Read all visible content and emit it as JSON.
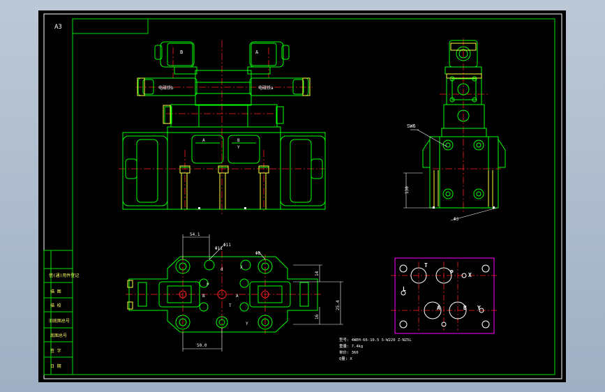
{
  "sheet": {
    "size_label": "A3"
  },
  "title_block": {
    "rows": [
      "借(通)用件登记",
      "描 图",
      "描 校",
      "旧底图总号",
      "底图总号",
      "签 字",
      "日 期"
    ]
  },
  "front_view": {
    "solenoid_left_letter": "B",
    "solenoid_right_letter": "A",
    "coil_left_label": "电磁铁b",
    "coil_right_label": "电磁铁a",
    "port_a": "A",
    "port_b": "B",
    "port_y": "Y"
  },
  "side_view": {
    "hex_label": "SW6",
    "height_dim": "130",
    "dia_label": "Φ3"
  },
  "top_view": {
    "dim_top": "54.1",
    "dim_bottom": "50.0",
    "dim_right": "25.4",
    "dim_right_small": "16",
    "dim_right_top": "14",
    "hole_label_1": "Φ11",
    "hole_label_2": "Φ8",
    "hole_label_3": "Φ11",
    "letters": {
      "X": "X",
      "d": "d",
      "P": "P",
      "B": "B",
      "A": "A",
      "T": "T",
      "Y": "Y"
    }
  },
  "port_diagram": {
    "letters": {
      "T": "T",
      "P": "P",
      "X": "X",
      "L": "L",
      "A": "A",
      "B": "B",
      "Y": "Y"
    }
  },
  "notes": {
    "line1": "型号: 4WEH-66-10.5 S-W220 Z-NZ5L",
    "line2": "重量: 7.4kg",
    "line3": "单价: 360",
    "line4": "Q量: X"
  }
}
